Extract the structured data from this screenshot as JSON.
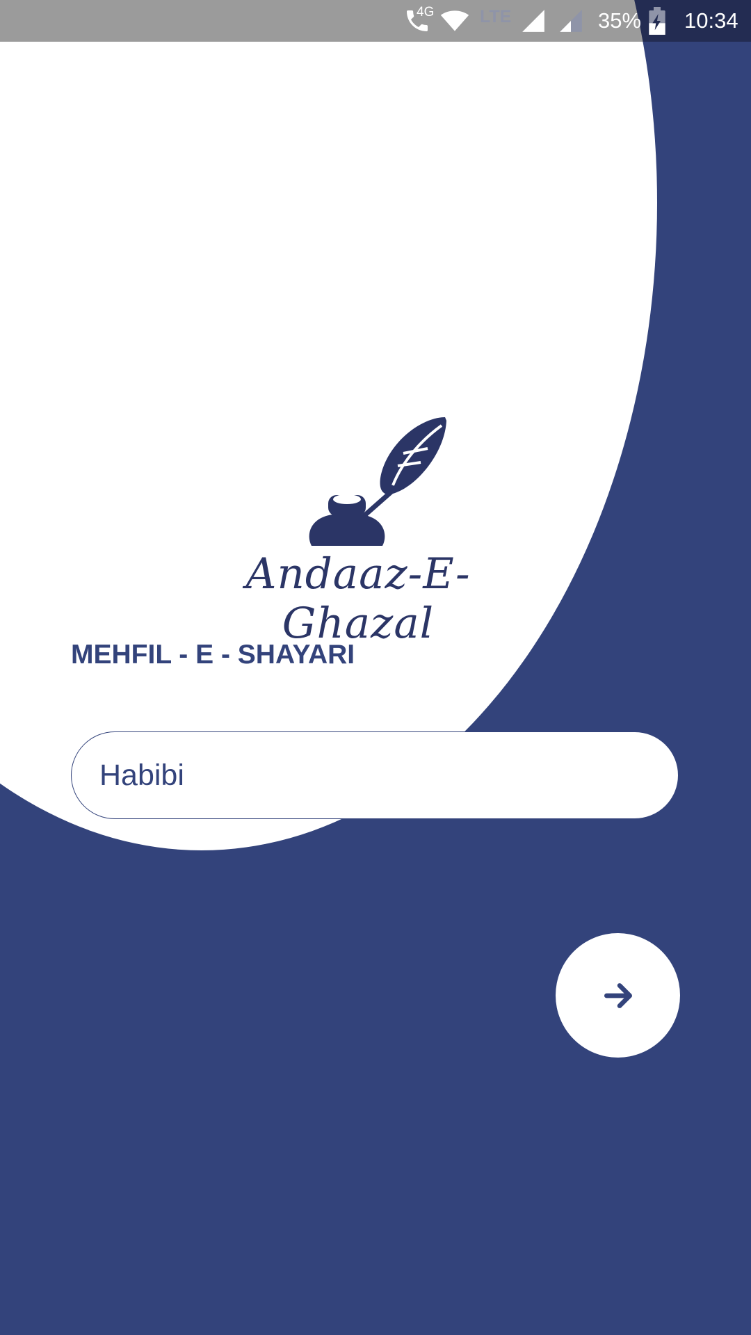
{
  "status_bar": {
    "network_label": "4G",
    "lte_label": "LTE",
    "battery": "35%",
    "time": "10:34",
    "icons": [
      "call-icon",
      "wifi-icon",
      "signal-icon",
      "signal-icon",
      "battery-charging-icon"
    ]
  },
  "logo": {
    "icon": "quill-inkpot-icon",
    "brand_name": "Andaaz-E-Ghazal"
  },
  "screen_title": "MEHFIL - E - SHAYARI",
  "name_input": {
    "value": "Habibi"
  },
  "next_button": {
    "icon": "arrow-right-icon"
  },
  "colors": {
    "primary": "#33437b",
    "dark": "#2b3566",
    "surface": "#ffffff",
    "status_bar_gray": "#9b9b9b"
  }
}
